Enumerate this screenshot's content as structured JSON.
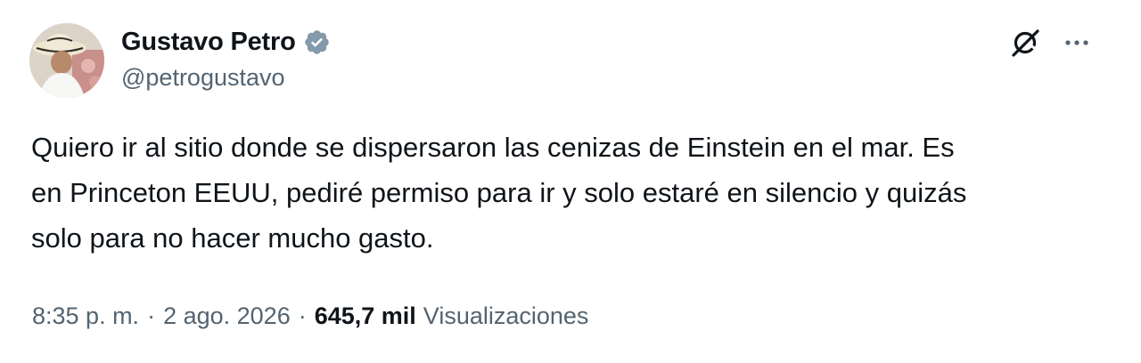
{
  "author": {
    "display_name": "Gustavo Petro",
    "handle": "@petrogustavo",
    "verified": true,
    "verified_color": "#829aab"
  },
  "tweet": {
    "text": "Quiero ir al sitio donde se dispersaron las cenizas de Einstein en el mar. Es\nen Princeton EEUU, pediré permiso para ir y solo estaré en silencio y quizás\nsolo para no hacer mucho gasto."
  },
  "meta": {
    "time": "8:35 p. m.",
    "separator": "·",
    "date": "2 ago. 2026",
    "views_count": "645,7 mil",
    "views_label": "Visualizaciones"
  },
  "icons": {
    "grok": "grok-icon",
    "more": "more-options-icon",
    "verified": "verified-badge-icon"
  },
  "colors": {
    "text_primary": "#0f1419",
    "text_secondary": "#536471"
  }
}
